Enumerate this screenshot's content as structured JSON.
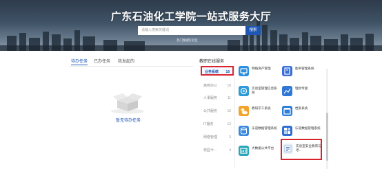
{
  "banner": {
    "title": "广东石油化工学院一站式服务大厅",
    "search_placeholder": "请输入搜索关键词",
    "search_button": "搜索",
    "hint_label": "热门搜索：",
    "hint_link": "实验室"
  },
  "tabs": [
    {
      "label": "待办任务",
      "active": true
    },
    {
      "label": "已办任务",
      "active": false
    },
    {
      "label": "我发起的",
      "active": false
    }
  ],
  "empty": {
    "text": "暂无待办任务"
  },
  "services": {
    "title": "教职在线服务",
    "categories": [
      {
        "label": "业务系统",
        "count": "18",
        "active": true
      },
      {
        "label": "离校办公",
        "count": "10",
        "active": false
      },
      {
        "label": "人事服务",
        "count": "11",
        "active": false
      },
      {
        "label": "公共服务",
        "count": "15",
        "active": false
      },
      {
        "label": "IT服务",
        "count": "12",
        "active": false
      },
      {
        "label": "网络管理",
        "count": "3",
        "active": false
      },
      {
        "label": "校园卡...",
        "count": "4",
        "active": false
      }
    ],
    "apps": [
      {
        "label": "网络资产管理",
        "color": "#2d8fe0",
        "icon": "network-asset-icon"
      },
      {
        "label": "图书管理系统",
        "color": "#3a6fd8",
        "icon": "book-icon"
      },
      {
        "label": "实验室管理信息系统",
        "color": "#2e9bd6",
        "icon": "lab-info-icon"
      },
      {
        "label": "理财专题",
        "color": "#2f78d6",
        "icon": "finance-icon"
      },
      {
        "label": "教研学工系统",
        "color": "#f3a32c",
        "icon": "weather-icon"
      },
      {
        "label": "档案系统",
        "color": "#2d7fd9",
        "icon": "archive-icon"
      },
      {
        "label": "乐道数据管理系统",
        "color": "#3a8ae0",
        "icon": "data-icon"
      },
      {
        "label": "乐道数据管理系统",
        "color": "#2f6fd2",
        "icon": "data-manage-icon"
      },
      {
        "label": "大数据公共平台",
        "color": "#2aa6b9",
        "icon": "data-platform-icon"
      },
      {
        "label": "实验室安全教育与考...",
        "color": "#e6eef8",
        "icon": "lab-safety-icon"
      }
    ]
  }
}
